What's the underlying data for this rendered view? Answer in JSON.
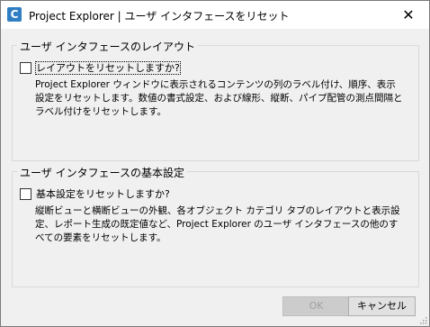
{
  "window": {
    "app_icon_letter": "C",
    "title": "Project Explorer | ユーザ インタフェースをリセット",
    "close_glyph": "✕"
  },
  "group1": {
    "heading": "ユーザ インタフェースのレイアウト",
    "checkbox_label": "レイアウトをリセットしますか?",
    "checked": false,
    "description": "Project Explorer ウィンドウに表示されるコンテンツの列のラベル付け、順序、表示設定をリセットします。数値の書式設定、および線形、縦断、パイプ配管の測点間隔とラベル付けをリセットします。"
  },
  "group2": {
    "heading": "ユーザ インタフェースの基本設定",
    "checkbox_label": "基本設定をリセットしますか?",
    "checked": false,
    "description": "縦断ビューと横断ビューの外観、各オブジェクト カテゴリ タブのレイアウトと表示設定、レポート生成の既定値など、Project Explorer のユーザ インタフェースの他のすべての要素をリセットします。"
  },
  "buttons": {
    "ok": "OK",
    "cancel": "キャンセル"
  },
  "colors": {
    "app_icon": "#2f7ec4",
    "background": "#f0f0f0",
    "titlebar": "#ffffff"
  }
}
